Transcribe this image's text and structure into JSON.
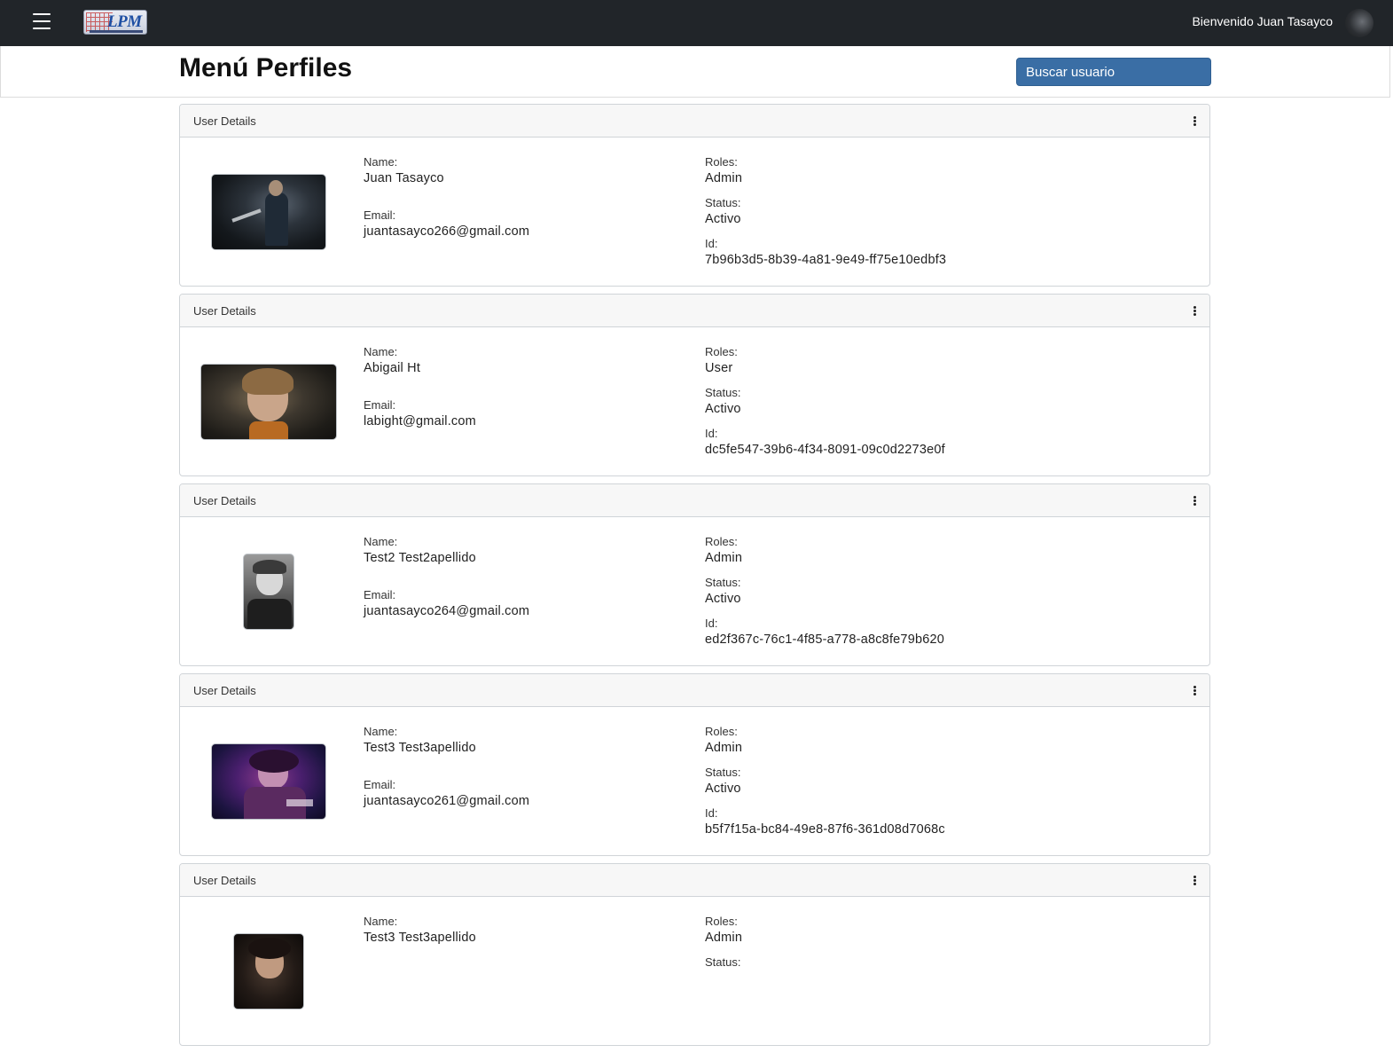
{
  "header": {
    "welcome": "Bienvenido Juan Tasayco",
    "logo_text": "LPM",
    "menu_icon": "hamburger-menu-icon",
    "avatar_icon": "user-avatar"
  },
  "page": {
    "title": "Menú Perfiles",
    "search_button": "Buscar usuario"
  },
  "labels": {
    "card_title": "User Details",
    "name": "Name:",
    "email": "Email:",
    "roles": "Roles:",
    "status": "Status:",
    "id": "Id:"
  },
  "users": [
    {
      "name": "Juan Tasayco",
      "email": "juantasayco266@gmail.com",
      "role": "Admin",
      "status": "Activo",
      "id": "7b96b3d5-8b39-4a81-9e49-ff75e10edbf3"
    },
    {
      "name": "Abigail Ht",
      "email": "labight@gmail.com",
      "role": "User",
      "status": "Activo",
      "id": "dc5fe547-39b6-4f34-8091-09c0d2273e0f"
    },
    {
      "name": "Test2 Test2apellido",
      "email": "juantasayco264@gmail.com",
      "role": "Admin",
      "status": "Activo",
      "id": "ed2f367c-76c1-4f85-a778-a8c8fe79b620"
    },
    {
      "name": "Test3 Test3apellido",
      "email": "juantasayco261@gmail.com",
      "role": "Admin",
      "status": "Activo",
      "id": "b5f7f15a-bc84-49e8-87f6-361d08d7068c"
    },
    {
      "name": "Test3 Test3apellido",
      "role": "Admin"
    }
  ]
}
